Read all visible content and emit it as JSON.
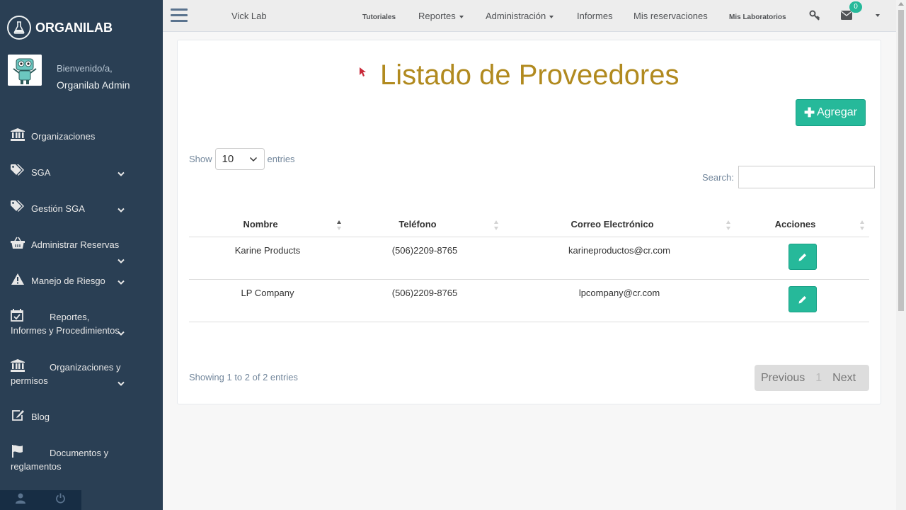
{
  "brand": {
    "name": "ORGANILAB"
  },
  "profile": {
    "welcome": "Bienvenido/a,",
    "name": "Organilab Admin"
  },
  "sidebar": {
    "items": [
      {
        "label": "Organizaciones",
        "icon": "bank-icon",
        "expandable": false
      },
      {
        "label": "SGA",
        "icon": "tags-icon",
        "expandable": true
      },
      {
        "label": "Gestión SGA",
        "icon": "tags-icon",
        "expandable": true
      },
      {
        "label": "Administrar Reservas",
        "icon": "basket-icon",
        "expandable": true
      },
      {
        "label": "Manejo de Riesgo",
        "icon": "warning-icon",
        "expandable": true
      },
      {
        "label": "Reportes, Informes y Procedimientos",
        "icon": "calendar-check-icon",
        "expandable": true
      },
      {
        "label": "Organizaciones y permisos",
        "icon": "bank-icon",
        "expandable": true
      },
      {
        "label": "Blog",
        "icon": "edit-icon",
        "expandable": false
      },
      {
        "label": "Documentos y reglamentos",
        "icon": "flag-icon",
        "expandable": false
      }
    ]
  },
  "topnav": {
    "lab": "Vick Lab",
    "tutoriales": "Tutoriales",
    "reportes": "Reportes",
    "administracion": "Administración",
    "informes": "Informes",
    "reservaciones": "Mis reservaciones",
    "laboratorios": "Mis Laboratorios",
    "mail_count": "0"
  },
  "main": {
    "title": "Listado de Proveedores",
    "add_label": "Agregar",
    "show_label": "Show",
    "entries_label": "entries",
    "page_length": "10",
    "search_label": "Search:",
    "search_value": "",
    "columns": [
      "Nombre",
      "Teléfono",
      "Correo Electrónico",
      "Acciones"
    ],
    "rows": [
      {
        "nombre": "Karine Products",
        "telefono": "(506)2209-8765",
        "correo": "karineproductos@cr.com"
      },
      {
        "nombre": "LP Company",
        "telefono": "(506)2209-8765",
        "correo": "lpcompany@cr.com"
      }
    ],
    "info": "Showing 1 to 2 of 2 entries",
    "pager": {
      "previous": "Previous",
      "current": "1",
      "next": "Next"
    }
  },
  "colors": {
    "sidebar_bg": "#2a3f54",
    "accent": "#26b99a",
    "title": "#b18a1f"
  }
}
